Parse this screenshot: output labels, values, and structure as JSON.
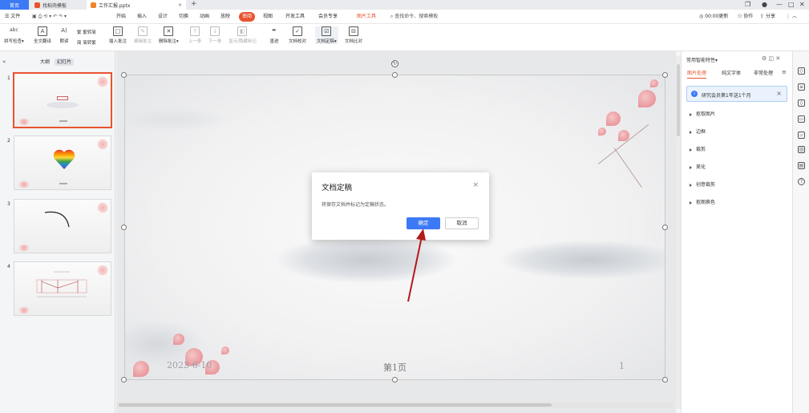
{
  "tabs": {
    "home": "首页",
    "doc1": "找稻壳模板",
    "doc2": "工作汇报.pptx",
    "add": "+"
  },
  "window": {
    "user": "●",
    "restore": "❐",
    "min": "—",
    "max": "□",
    "close": "✕"
  },
  "menu": {
    "file": "☰ 文件",
    "items": [
      "开始",
      "插入",
      "设计",
      "切换",
      "动画",
      "放映",
      "审阅",
      "视图",
      "开发工具",
      "会员专享"
    ],
    "active": "审阅",
    "picture_tools": "图片工具",
    "search": "查找命令、搜索模板",
    "update": "◎ 00:00更新",
    "collab": "协作",
    "share": "分享"
  },
  "ribbon": {
    "spell": "拼写检查▾",
    "translate": "全文翻译",
    "read": "朗读",
    "simp_trad": "繁转简",
    "trad_simp": "简转繁",
    "insert_comment": "插入批注",
    "edit_comment": "编辑批注",
    "delete_comment": "删除批注▾",
    "prev": "上一条",
    "next": "下一条",
    "show_hide": "显示/隐藏标记",
    "ink": "墨迹",
    "verify": "文档校对",
    "finalize": "文档定稿▾",
    "compare": "文档比对"
  },
  "left_panel": {
    "tab_outline": "大纲",
    "tab_slides": "幻灯片",
    "slide_numbers": [
      "1",
      "2",
      "3",
      "4"
    ]
  },
  "slide": {
    "date": "2023-6-10",
    "page": "第1页",
    "number": "1"
  },
  "dialog": {
    "title": "文档定稿",
    "message": "将保存文档并标记为定稿状态。",
    "ok": "确定",
    "cancel": "取消",
    "close": "×"
  },
  "right_panel": {
    "title": "常用智能特性▾",
    "tabs": [
      "图片处理",
      "纯文字体",
      "非常处理"
    ],
    "active_tab": "图片处理",
    "banner": "研究会员第1年送1个月",
    "items": [
      "抠取图片",
      "边框",
      "裁剪",
      "美化",
      "创意裁剪",
      "抠图换色"
    ]
  },
  "colors": {
    "accent": "#e8542e",
    "primary": "#3c7af5",
    "arrow": "#b31b1b"
  }
}
